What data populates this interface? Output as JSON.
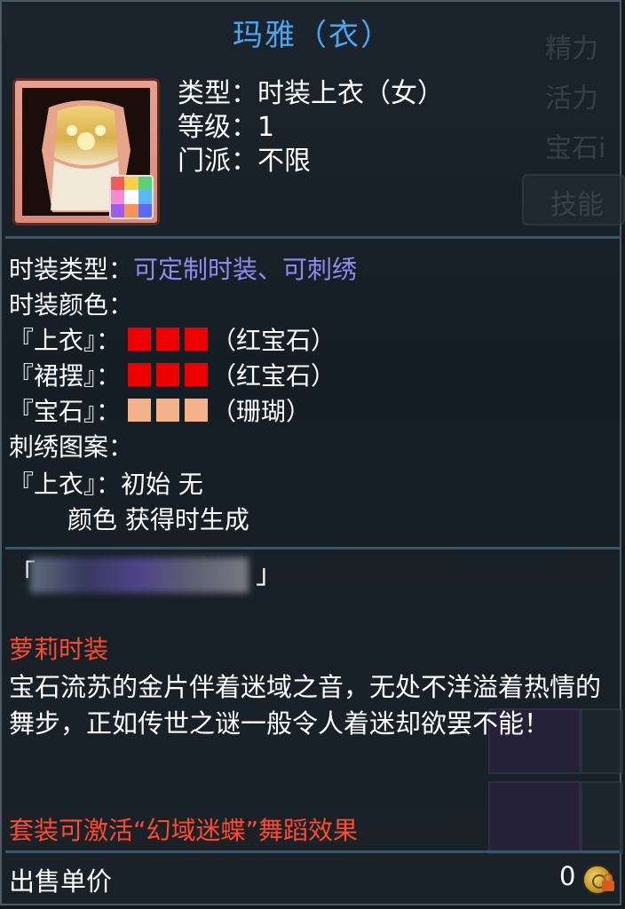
{
  "item": {
    "name": "玛雅（衣）",
    "info": {
      "type": "类型：时装上衣（女）",
      "level": "等级：1",
      "sect": "门派：不限"
    }
  },
  "fashion": {
    "type_label": "时装类型：",
    "type_value": "可定制时装、可刺绣",
    "color_label": "时装颜色：",
    "color_rows": [
      {
        "part": "『上衣』：",
        "colors": [
          "#ee0000",
          "#ee0000",
          "#ee0000"
        ],
        "desc": "（红宝石）"
      },
      {
        "part": "『裙摆』：",
        "colors": [
          "#ee0000",
          "#ee0000",
          "#ee0000"
        ],
        "desc": "（红宝石）"
      },
      {
        "part": "『宝石』：",
        "colors": [
          "#f4b289",
          "#f4b289",
          "#f4b289"
        ],
        "desc": "（珊瑚）"
      }
    ]
  },
  "embroidery": {
    "label": "刺绣图案：",
    "row1": "『上衣』：初始 无",
    "row2": "颜色 获得时生成"
  },
  "signature": {
    "open": "「",
    "close": "」"
  },
  "lore": {
    "title": "萝莉时装",
    "text": "宝石流苏的金片伴着迷域之音，无处不洋溢着热情的舞步，正如传世之谜一般令人着迷却欲罢不能！",
    "set_bonus": "套装可激活“幻域迷蝶”舞蹈效果"
  },
  "price": {
    "label": "出售单价",
    "value": "0"
  },
  "background_ui": {
    "labels": [
      "精力",
      "活力",
      "宝石i",
      "技能"
    ]
  },
  "colors": {
    "title": "#4aa6f0",
    "highlight": "#8e8cf0",
    "red_text": "#ff4a2c",
    "divider": "#3e5566"
  },
  "icons": [
    "item-icon",
    "dye-palette-icon",
    "coin-icon",
    "lock-icon"
  ]
}
